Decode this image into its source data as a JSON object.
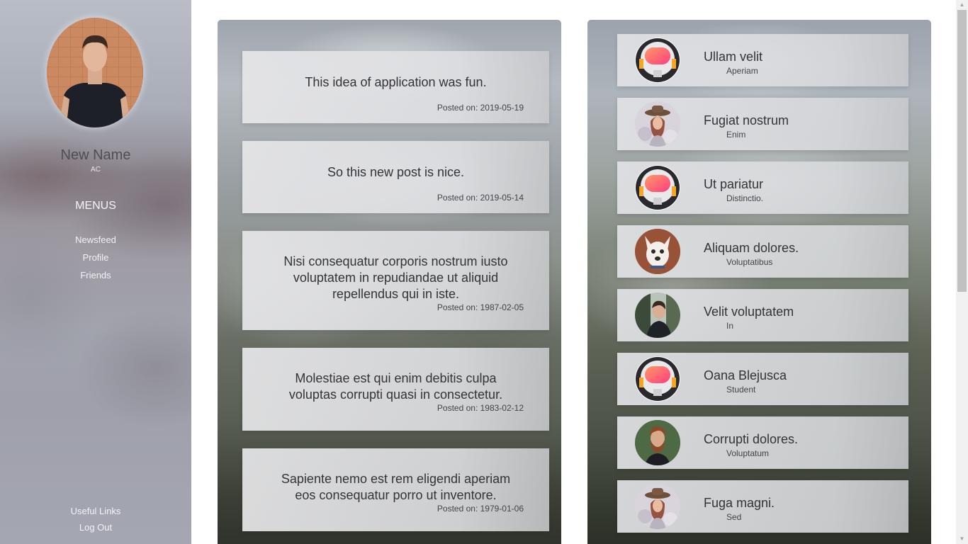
{
  "profile": {
    "name": "New Name",
    "sub": "AC",
    "menus_title": "MENUS",
    "menu_items": [
      {
        "label": "Newsfeed"
      },
      {
        "label": "Profile"
      },
      {
        "label": "Friends"
      }
    ],
    "bottom_links": [
      {
        "label": "Useful Links"
      },
      {
        "label": "Log Out"
      }
    ]
  },
  "posts": [
    {
      "text": "This idea of application was fun.",
      "date": "Posted on: 2019-05-19"
    },
    {
      "text": "So this new post is nice.",
      "date": "Posted on: 2019-05-14"
    },
    {
      "text": "Nisi consequatur corporis nostrum iusto voluptatem in repudiandae ut aliquid repellendus qui in iste.",
      "date": "Posted on: 1987-02-05"
    },
    {
      "text": "Molestiae est qui enim debitis culpa voluptas corrupti quasi in consectetur.",
      "date": "Posted on: 1983-02-12"
    },
    {
      "text": "Sapiente nemo est rem eligendi aperiam eos consequatur porro ut inventore.",
      "date": "Posted on: 1979-01-06"
    }
  ],
  "friends": [
    {
      "name": "Ullam velit",
      "role": "Aperiam",
      "avatar": "astronaut-avatar"
    },
    {
      "name": "Fugiat nostrum",
      "role": "Enim",
      "avatar": "woman-hat-avatar"
    },
    {
      "name": "Ut pariatur",
      "role": "Distinctio.",
      "avatar": "astronaut-avatar"
    },
    {
      "name": "Aliquam dolores.",
      "role": "Voluptatibus",
      "avatar": "dog-avatar"
    },
    {
      "name": "Velit voluptatem",
      "role": "In",
      "avatar": "man-avatar"
    },
    {
      "name": "Oana Blejusca",
      "role": "Student",
      "avatar": "astronaut-avatar"
    },
    {
      "name": "Corrupti dolores.",
      "role": "Voluptatum",
      "avatar": "bearded-man-avatar"
    },
    {
      "name": "Fuga magni.",
      "role": "Sed",
      "avatar": "woman-hat-avatar"
    }
  ],
  "colors": {
    "text": "#333338",
    "sidebar_text": "#f2f2f6"
  }
}
